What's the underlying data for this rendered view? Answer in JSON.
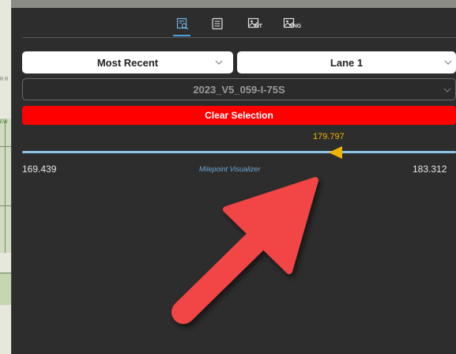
{
  "tabs": [
    {
      "icon": "search-layer-icon",
      "sub": ""
    },
    {
      "icon": "list-icon",
      "sub": ""
    },
    {
      "icon": "image-int-icon",
      "sub": "INT"
    },
    {
      "icon": "image-rng-icon",
      "sub": "RNG"
    }
  ],
  "filters": {
    "sort_value": "Most Recent",
    "lane_value": "Lane 1",
    "run_value": "2023_V5_059-I-75S"
  },
  "clear_selection_label": "Clear Selection",
  "milepoint": {
    "current": "179.797",
    "min": "169.439",
    "max": "183.312",
    "caption": "Milepoint Visualizer",
    "position_fraction": 0.74
  },
  "map_labels": [
    "R R",
    "EW"
  ],
  "colors": {
    "panel_bg": "#2d2d2d",
    "accent_blue": "#4aa3df",
    "clear_red": "#ff0000",
    "thumb_yellow": "#f0b400",
    "annotation_arrow": "#f24444"
  }
}
